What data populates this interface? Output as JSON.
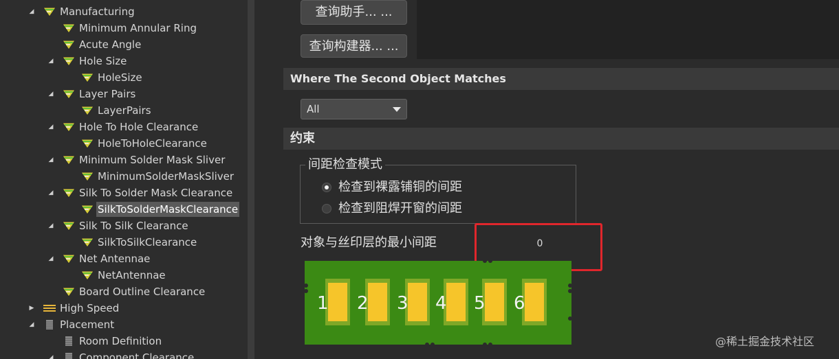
{
  "tree": {
    "items": [
      {
        "label": "Manufacturing",
        "toggle": "◢",
        "icon": "rule-class-icon"
      },
      {
        "label": "Minimum Annular Ring",
        "toggle": "",
        "icon": "rule-icon"
      },
      {
        "label": "Acute Angle",
        "toggle": "",
        "icon": "rule-icon"
      },
      {
        "label": "Hole Size",
        "toggle": "◢",
        "icon": "rule-icon"
      },
      {
        "label": "HoleSize",
        "toggle": "",
        "icon": "rule-icon"
      },
      {
        "label": "Layer Pairs",
        "toggle": "◢",
        "icon": "rule-icon"
      },
      {
        "label": "LayerPairs",
        "toggle": "",
        "icon": "rule-icon"
      },
      {
        "label": "Hole To Hole Clearance",
        "toggle": "◢",
        "icon": "rule-icon"
      },
      {
        "label": "HoleToHoleClearance",
        "toggle": "",
        "icon": "rule-icon"
      },
      {
        "label": "Minimum Solder Mask Sliver",
        "toggle": "◢",
        "icon": "rule-icon"
      },
      {
        "label": "MinimumSolderMaskSliver",
        "toggle": "",
        "icon": "rule-icon"
      },
      {
        "label": "Silk To Solder Mask Clearance",
        "toggle": "◢",
        "icon": "rule-icon"
      },
      {
        "label": "SilkToSolderMaskClearance",
        "toggle": "",
        "icon": "rule-icon"
      },
      {
        "label": "Silk To Silk Clearance",
        "toggle": "◢",
        "icon": "rule-icon"
      },
      {
        "label": "SilkToSilkClearance",
        "toggle": "",
        "icon": "rule-icon"
      },
      {
        "label": "Net Antennae",
        "toggle": "◢",
        "icon": "rule-icon"
      },
      {
        "label": "NetAntennae",
        "toggle": "",
        "icon": "rule-icon"
      },
      {
        "label": "Board Outline Clearance",
        "toggle": "",
        "icon": "rule-icon"
      },
      {
        "label": "High Speed",
        "toggle": "▶",
        "icon": "high-speed-icon"
      },
      {
        "label": "Placement",
        "toggle": "◢",
        "icon": "placement-icon"
      },
      {
        "label": "Room Definition",
        "toggle": "",
        "icon": "placement-rule-icon"
      },
      {
        "label": "Component Clearance",
        "toggle": "◢",
        "icon": "placement-rule-icon"
      }
    ]
  },
  "buttons": {
    "query_helper": "查询助手... ...",
    "query_builder": "查询构建器... ..."
  },
  "second_object": {
    "header": "Where The Second Object Matches",
    "selected": "All"
  },
  "constraints": {
    "header": "约束",
    "group_title": "间距检查模式",
    "radio_options": [
      {
        "label": "检查到裸露铺铜的间距",
        "checked": true
      },
      {
        "label": "检查到阻焊开窗的间距",
        "checked": false
      }
    ],
    "min_distance_label": "对象与丝印层的最小间距",
    "min_distance_value": "0"
  },
  "pcb_diagram": {
    "labels": [
      "1",
      "2",
      "3",
      "4",
      "5",
      "6"
    ],
    "board_color": "#3b8a14",
    "pad_color": "#f6c52a"
  },
  "watermark": "@稀土掘金技术社区",
  "colors": {
    "highlight_box": "#e0262c",
    "rule_icon": "#e8d44a"
  }
}
